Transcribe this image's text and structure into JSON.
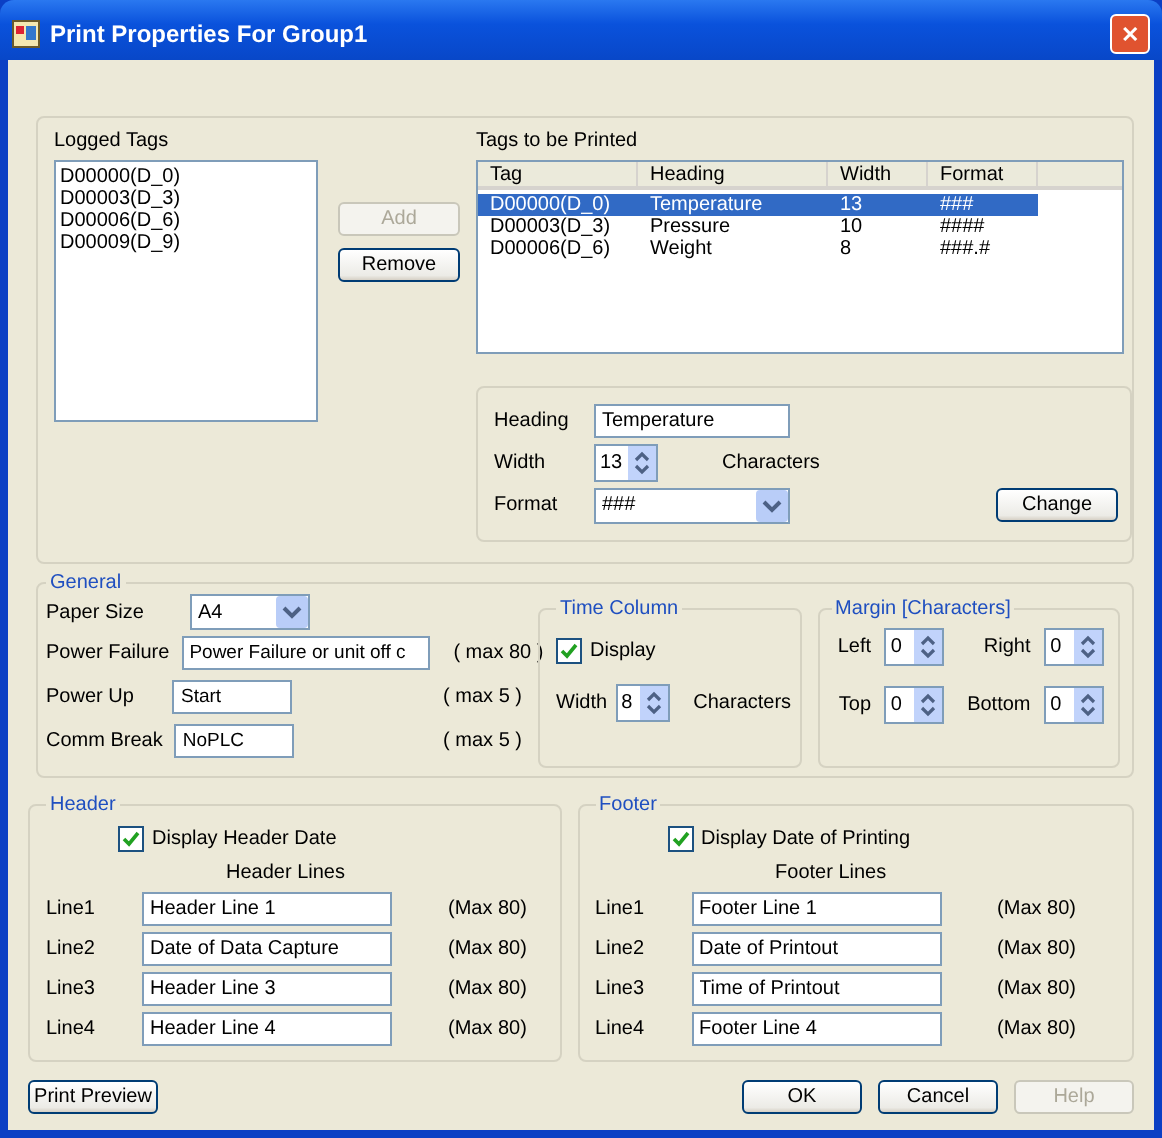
{
  "window": {
    "title": "Print Properties For Group1",
    "close": "✕"
  },
  "logged_tags": {
    "label": "Logged Tags",
    "items": [
      {
        "text": "D00000(D_0)",
        "selected": false
      },
      {
        "text": "D00003(D_3)",
        "selected": false
      },
      {
        "text": "D00006(D_6)",
        "selected": false
      },
      {
        "text": "D00009(D_9)",
        "selected": false
      }
    ]
  },
  "transfer_buttons": [
    {
      "label": "Add",
      "disabled": true
    },
    {
      "label": "Remove",
      "disabled": false
    }
  ],
  "tags_to_print": {
    "label": "Tags to be Printed",
    "columns": [
      "Tag",
      "Heading",
      "Width",
      "Format"
    ],
    "rows": [
      {
        "cells": [
          "D00000(D_0)",
          "Temperature",
          "13",
          "###"
        ],
        "selected": true
      },
      {
        "cells": [
          "D00003(D_3)",
          "Pressure",
          "10",
          "####"
        ],
        "selected": false
      },
      {
        "cells": [
          "D00006(D_6)",
          "Weight",
          "8",
          "###.#"
        ],
        "selected": false
      }
    ]
  },
  "editor": {
    "heading_label": "Heading",
    "heading_value": "Temperature",
    "width_label": "Width",
    "width_value": "13",
    "width_unit": "Characters",
    "format_label": "Format",
    "format_value": "###",
    "change_button": "Change"
  },
  "general": {
    "legend": "General",
    "paper_size_label": "Paper Size",
    "paper_size": "A4",
    "fields": [
      {
        "label": "Power Failure",
        "value": "Power Failure or unit off c",
        "hint": "( max 80 )",
        "wide": true
      },
      {
        "label": "Power Up",
        "value": "Start",
        "hint": "( max 5 )",
        "wide": false
      },
      {
        "label": "Comm Break",
        "value": "NoPLC",
        "hint": "( max 5 )",
        "wide": false
      }
    ]
  },
  "time_column": {
    "legend": "Time Column",
    "display_label": "Display",
    "display_checked": true,
    "width_label": "Width",
    "width_value": "8",
    "width_unit": "Characters"
  },
  "margin": {
    "legend": "Margin [Characters]",
    "fields": [
      {
        "label": "Left",
        "value": "0"
      },
      {
        "label": "Right",
        "value": "0"
      },
      {
        "label": "Top",
        "value": "0"
      },
      {
        "label": "Bottom",
        "value": "0"
      }
    ]
  },
  "header": {
    "legend": "Header",
    "checkbox_label": "Display Header Date",
    "checked": true,
    "lines_title": "Header Lines",
    "lines": [
      {
        "label": "Line1",
        "value": "Header Line 1",
        "hint": "(Max 80)"
      },
      {
        "label": "Line2",
        "value": "Date of Data Capture",
        "hint": "(Max 80)"
      },
      {
        "label": "Line3",
        "value": "Header Line 3",
        "hint": "(Max 80)"
      },
      {
        "label": "Line4",
        "value": "Header Line 4",
        "hint": "(Max 80)"
      }
    ]
  },
  "footer": {
    "legend": "Footer",
    "checkbox_label": "Display Date of Printing",
    "checked": true,
    "lines_title": "Footer Lines",
    "lines": [
      {
        "label": "Line1",
        "value": "Footer Line 1",
        "hint": "(Max 80)"
      },
      {
        "label": "Line2",
        "value": "Date of Printout",
        "hint": "(Max 80)"
      },
      {
        "label": "Line3",
        "value": "Time of Printout",
        "hint": "(Max 80)"
      },
      {
        "label": "Line4",
        "value": "Footer Line 4",
        "hint": "(Max 80)"
      }
    ]
  },
  "buttons": [
    {
      "label": "Print Preview",
      "disabled": false
    },
    {
      "label": "OK",
      "disabled": false
    },
    {
      "label": "Cancel",
      "disabled": false
    },
    {
      "label": "Help",
      "disabled": true
    }
  ]
}
